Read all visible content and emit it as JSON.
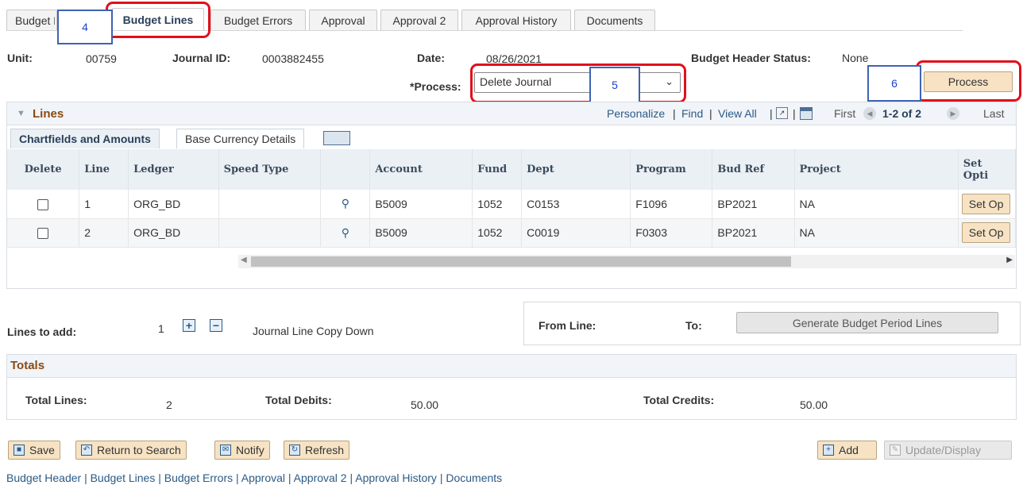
{
  "tabs": [
    {
      "label": "Budget Header"
    },
    {
      "label": "Budget Lines"
    },
    {
      "label": "Budget Errors"
    },
    {
      "label": "Approval"
    },
    {
      "label": "Approval 2"
    },
    {
      "label": "Approval History"
    },
    {
      "label": "Documents"
    }
  ],
  "callouts": {
    "n4": "4",
    "n5": "5",
    "n6": "6"
  },
  "header": {
    "unit_label": "Unit:",
    "unit_value": "00759",
    "journal_label": "Journal ID:",
    "journal_value": "0003882455",
    "date_label": "Date:",
    "date_value": "08/26/2021",
    "status_label": "Budget Header Status:",
    "status_value": "None",
    "process_label": "*Process:",
    "process_value": "Delete Journal",
    "process_button": "Process"
  },
  "lines_panel": {
    "title": "Lines",
    "personalize": "Personalize",
    "find": "Find",
    "view_all": "View All",
    "first": "First",
    "range": "1-2 of 2",
    "last": "Last",
    "subtabs": [
      "Chartfields and Amounts",
      "Base Currency Details"
    ],
    "columns": [
      "Delete",
      "Line",
      "Ledger",
      "Speed Type",
      "",
      "Account",
      "Fund",
      "Dept",
      "Program",
      "Bud Ref",
      "Project",
      "Set Opti"
    ],
    "rows": [
      {
        "line": "1",
        "ledger": "ORG_BD",
        "speed": "",
        "account": "B5009",
        "fund": "1052",
        "dept": "C0153",
        "program": "F1096",
        "budref": "BP2021",
        "project": "NA",
        "setopt": "Set Op"
      },
      {
        "line": "2",
        "ledger": "ORG_BD",
        "speed": "",
        "account": "B5009",
        "fund": "1052",
        "dept": "C0019",
        "program": "F0303",
        "budref": "BP2021",
        "project": "NA",
        "setopt": "Set Op"
      }
    ]
  },
  "add_lines": {
    "label": "Lines to add:",
    "count": "1",
    "copy_down": "Journal Line Copy Down",
    "from_line": "From Line:",
    "to": "To:",
    "generate": "Generate Budget Period Lines"
  },
  "totals": {
    "title": "Totals",
    "lines_label": "Total Lines:",
    "lines_value": "2",
    "debits_label": "Total Debits:",
    "debits_value": "50.00",
    "credits_label": "Total Credits:",
    "credits_value": "50.00"
  },
  "buttons": {
    "save": "Save",
    "return": "Return to Search",
    "notify": "Notify",
    "refresh": "Refresh",
    "add": "Add",
    "update": "Update/Display"
  },
  "footer": "Budget Header | Budget Lines | Budget Errors | Approval | Approval 2 | Approval History | Documents",
  "colors": {
    "callout": "#e0101b",
    "numbox": "#3f62b4",
    "accent_button": "#f7e3c4"
  }
}
